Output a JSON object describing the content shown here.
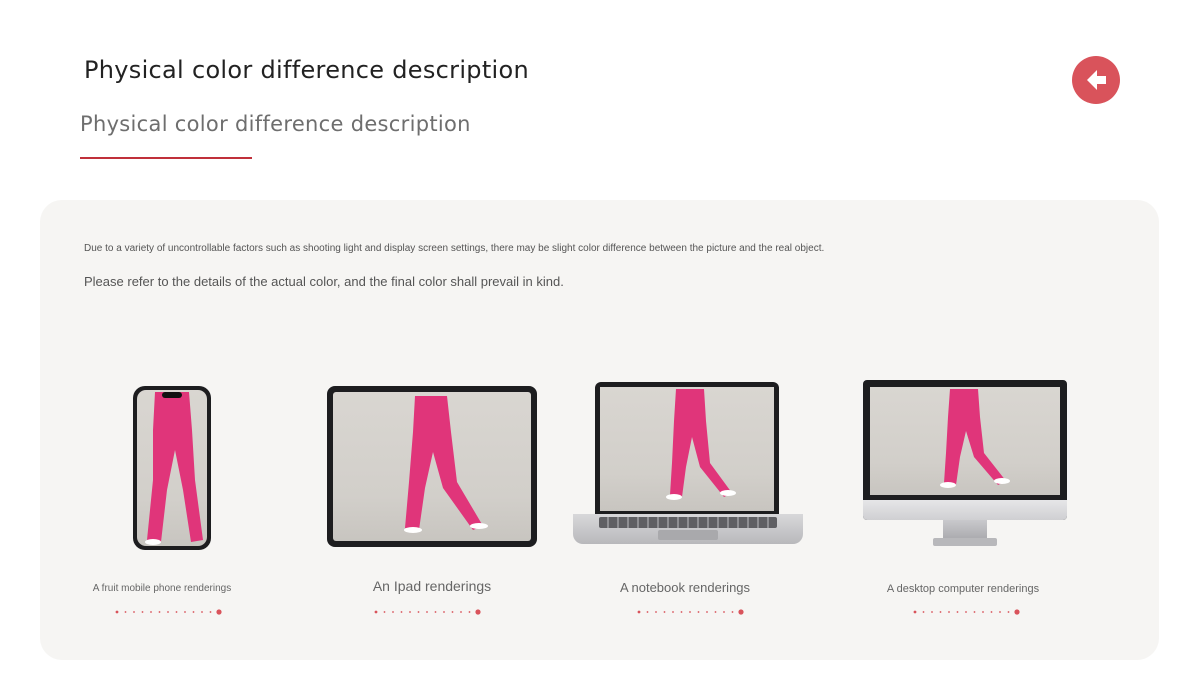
{
  "header": {
    "title": "Physical color difference description",
    "subtitle": "Physical color difference description"
  },
  "back_button": {
    "icon": "arrow-left-icon",
    "color": "#d9535b"
  },
  "panel": {
    "note_small": "Due to a variety of uncontrollable factors such as shooting light and display screen settings, there may be slight color difference between the picture and the real object.",
    "note_main": "Please refer to the details of the actual color, and the final color shall prevail in kind."
  },
  "devices": [
    {
      "caption": "A fruit mobile phone renderings"
    },
    {
      "caption": "An Ipad renderings"
    },
    {
      "caption": "A notebook renderings"
    },
    {
      "caption": "A desktop computer renderings"
    }
  ],
  "colors": {
    "accent": "#c0303a",
    "pants": "#e0357a",
    "panel": "#f6f5f3"
  }
}
